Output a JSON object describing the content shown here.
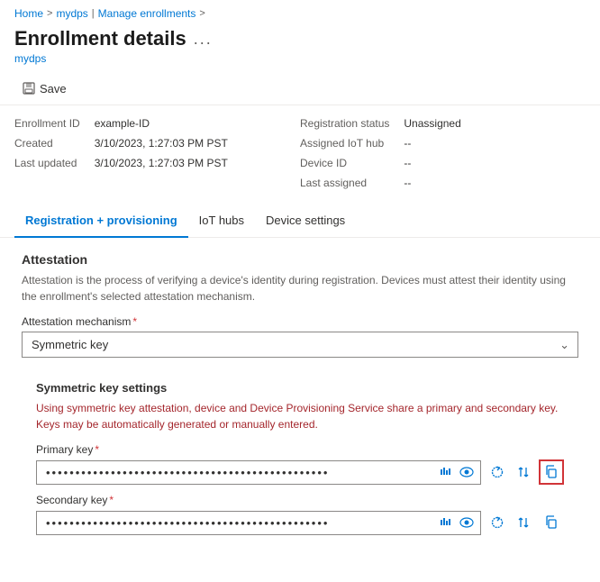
{
  "breadcrumb": {
    "home": "Home",
    "sep1": ">",
    "mydps_link": "mydps",
    "sep2": "|",
    "manage": "Manage enrollments",
    "sep3": ">"
  },
  "header": {
    "title": "Enrollment details",
    "ellipsis": "...",
    "subtitle": "mydps"
  },
  "toolbar": {
    "save_label": "Save"
  },
  "info": {
    "left": {
      "enrollment_id_label": "Enrollment ID",
      "enrollment_id_value": "example-ID",
      "created_label": "Created",
      "created_value": "3/10/2023, 1:27:03 PM PST",
      "last_updated_label": "Last updated",
      "last_updated_value": "3/10/2023, 1:27:03 PM PST"
    },
    "right": {
      "reg_status_label": "Registration status",
      "reg_status_value": "Unassigned",
      "assigned_iot_label": "Assigned IoT hub",
      "assigned_iot_value": "--",
      "device_id_label": "Device ID",
      "device_id_value": "--",
      "last_assigned_label": "Last assigned",
      "last_assigned_value": "--"
    }
  },
  "tabs": [
    {
      "id": "reg",
      "label": "Registration + provisioning",
      "active": true
    },
    {
      "id": "iot",
      "label": "IoT hubs",
      "active": false
    },
    {
      "id": "device",
      "label": "Device settings",
      "active": false
    }
  ],
  "attestation": {
    "title": "Attestation",
    "desc": "Attestation is the process of verifying a device's identity during registration. Devices must attest their identity using the enrollment's selected attestation mechanism.",
    "mechanism_label": "Attestation mechanism",
    "mechanism_value": "Symmetric key"
  },
  "sym_key": {
    "title": "Symmetric key settings",
    "desc": "Using symmetric key attestation, device and Device Provisioning Service share a primary and secondary key. Keys may be automatically generated or manually entered.",
    "primary_label": "Primary key",
    "secondary_label": "Secondary key",
    "primary_dots": "••••••••••••••••••••••••••••••••••••••••••••••••••••••••••••••••••••••••••••••••••",
    "secondary_dots": "••••••••••••••••••••••••••••••••••••••••••••••••••••••••••••••••••••••••••••••••••"
  }
}
